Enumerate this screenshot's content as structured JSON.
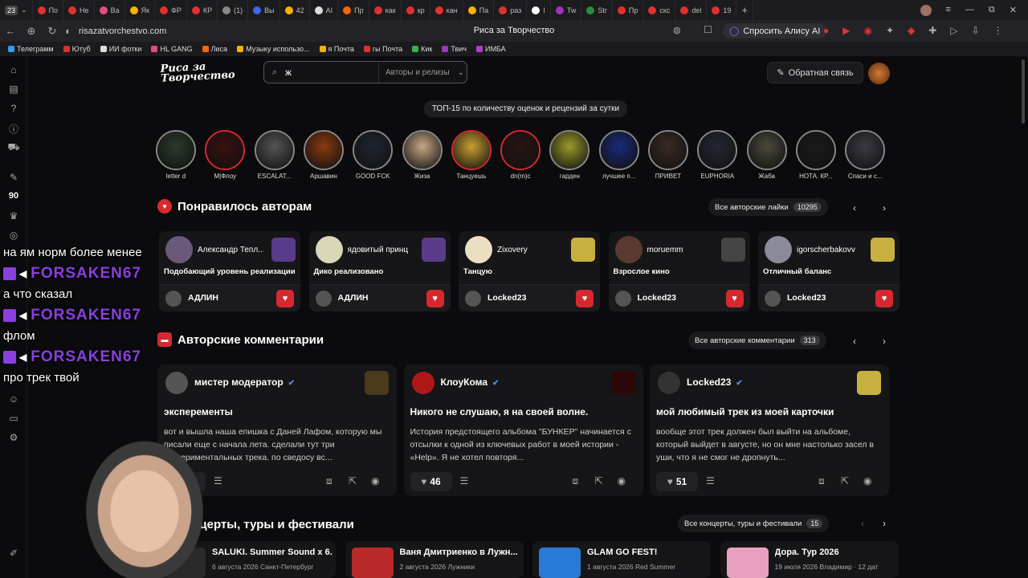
{
  "browser": {
    "tab_count": "23",
    "tabs": [
      {
        "label": "По",
        "color": "#e03131"
      },
      {
        "label": "Не",
        "color": "#e03131"
      },
      {
        "label": "Ва",
        "color": "#e64980"
      },
      {
        "label": "Як",
        "color": "#fab005"
      },
      {
        "label": "ФР",
        "color": "#e03131"
      },
      {
        "label": "КР",
        "color": "#e03131"
      },
      {
        "label": "(1)",
        "color": "#888888"
      },
      {
        "label": "Вы",
        "color": "#4263eb"
      },
      {
        "label": "42",
        "color": "#fab005"
      },
      {
        "label": "АI",
        "color": "#dddddd"
      },
      {
        "label": "Пр",
        "color": "#f76707"
      },
      {
        "label": "как",
        "color": "#e03131"
      },
      {
        "label": "кр",
        "color": "#e03131"
      },
      {
        "label": "кан",
        "color": "#e03131"
      },
      {
        "label": "Па",
        "color": "#fab005"
      },
      {
        "label": "раз",
        "color": "#e03131"
      },
      {
        "label": "I",
        "color": "#ffffff"
      },
      {
        "label": "Tw",
        "color": "#9c36b5"
      },
      {
        "label": "Str",
        "color": "#2b8a3e"
      },
      {
        "label": "Пр",
        "color": "#e03131"
      },
      {
        "label": "скс",
        "color": "#e03131"
      },
      {
        "label": "del",
        "color": "#e03131"
      },
      {
        "label": "19",
        "color": "#e03131"
      }
    ],
    "url": "risazatvorchestvo.com",
    "page_title": "Риса за Творчество",
    "alice_label": "Спросить Алису AI",
    "bookmarks": [
      {
        "label": "Телеграмм",
        "color": "#339af0"
      },
      {
        "label": "Ютуб",
        "color": "#e03131"
      },
      {
        "label": "ИИ фотки",
        "color": "#dddddd"
      },
      {
        "label": "HL GANG",
        "color": "#e64980"
      },
      {
        "label": "Лиса",
        "color": "#f76707"
      },
      {
        "label": "Музыку использо...",
        "color": "#fab005"
      },
      {
        "label": "я Почта",
        "color": "#fab005"
      },
      {
        "label": "гы Почта",
        "color": "#e03131"
      },
      {
        "label": "Кик",
        "color": "#37b24d"
      },
      {
        "label": "Твич",
        "color": "#9c36b5"
      },
      {
        "label": "ИМБА",
        "color": "#ae3ec9"
      }
    ]
  },
  "site": {
    "logo": "Риса за Творчество",
    "search_value": "ж",
    "search_scope": "Авторы и релизы",
    "feedback_label": "Обратная связь",
    "leftbar_number": "90"
  },
  "top15": {
    "badge": "ТОП-15 по количеству оценок и рецензий за сутки",
    "items": [
      {
        "label": "letter d",
        "red": false,
        "color": "#2b3a2b"
      },
      {
        "label": "M|Флоу",
        "red": true,
        "color": "#3a1010"
      },
      {
        "label": "ESCALAT...",
        "red": false,
        "color": "#555555"
      },
      {
        "label": "Аршавин",
        "red": false,
        "color": "#8a3a10"
      },
      {
        "label": "GOOD FCK",
        "red": false,
        "color": "#1f2630"
      },
      {
        "label": "Жиза",
        "red": false,
        "color": "#c9a884"
      },
      {
        "label": "Танцуешь",
        "red": true,
        "color": "#c8a030"
      },
      {
        "label": "dn(m)c",
        "red": true,
        "color": "#2a1414"
      },
      {
        "label": "гарден",
        "red": false,
        "color": "#9a9a2a"
      },
      {
        "label": "лучшее п...",
        "red": false,
        "color": "#1a2a7a"
      },
      {
        "label": "ПРИВЕТ",
        "red": false,
        "color": "#3a2a24"
      },
      {
        "label": "EUPHORIA",
        "red": false,
        "color": "#242833"
      },
      {
        "label": "Жаба",
        "red": false,
        "color": "#4a4a3a"
      },
      {
        "label": "НОТА. КР...",
        "red": false,
        "color": "#1a1a1a"
      },
      {
        "label": "Спаси и с...",
        "red": false,
        "color": "#3a3a44"
      }
    ]
  },
  "liked": {
    "title": "Понравилось авторам",
    "all_label": "Все авторские лайки",
    "all_count": "10295",
    "cards": [
      {
        "author": "Александр Тепл...",
        "evaluation": "Подобающий уровень реализации",
        "user": "АДЛИН",
        "ava": "#6a5a7a",
        "cover": "#5a3a8a"
      },
      {
        "author": "ядовитый принц",
        "evaluation": "Дико реализовано",
        "user": "АДЛИН",
        "ava": "#d8d8b8",
        "cover": "#5a3a8a"
      },
      {
        "author": "Zixovery",
        "evaluation": "Танцую",
        "user": "Locked23",
        "ava": "#e8e0c0",
        "cover": "#c8b040"
      },
      {
        "author": "moruemm",
        "evaluation": "Взрослое кино",
        "user": "Locked23",
        "ava": "#5a3a30",
        "cover": "#444444"
      },
      {
        "author": "igorscherbakovv",
        "evaluation": "Отличный баланс",
        "user": "Locked23",
        "ava": "#8a8a9a",
        "cover": "#c8b040"
      }
    ]
  },
  "comments": {
    "title": "Авторские комментарии",
    "all_label": "Все авторские комментарии",
    "all_count": "313",
    "cards": [
      {
        "author": "мистер модератор",
        "headline": "эксперементы",
        "text": "вот и вышла наша епишка с Даней Лафом, которую мы писали еще с начала лета. сделали тут три экспериментальных трека. по сведосу вс...",
        "likes": "17",
        "ava": "#555555",
        "cover": "#4a3a1a"
      },
      {
        "author": "КлоуКома",
        "headline": "Никого не слушаю, я на своей волне.",
        "text": "История предстоящего альбома \"БУНКЕР\" начинается с отсылки к одной из ключевых работ в моей истории - «Help». Я не хотел повторя...",
        "likes": "46",
        "ava": "#b01818",
        "cover": "#2a0808"
      },
      {
        "author": "Locked23",
        "headline": "мой любимый трек из моей карточки",
        "text": "вообще этот трек должен был выйти на альбоме, который выйдет в августе, но он мне настолько засел в уши, что я не смог не дропнуть...",
        "likes": "51",
        "ava": "#333333",
        "cover": "#c8b040"
      }
    ]
  },
  "events": {
    "title": "Концерты, туры и фестивали",
    "all_label": "Все концерты, туры и фестивали",
    "all_count": "15",
    "cards": [
      {
        "title": "SALUKI. Summer Sound x 6...",
        "meta": "6 августа 2026  Санкт-Петербург",
        "cover": "#2a2a2a"
      },
      {
        "title": "Ваня Дмитриенко в Лужн...",
        "meta": "2 августа 2026  Лужники",
        "cover": "#b82a2a"
      },
      {
        "title": "GLAM GO FEST!",
        "meta": "1 августа 2026  Red Summer",
        "cover": "#2a7ad8"
      },
      {
        "title": "Дора. Тур 2026",
        "meta": "19 июля 2026  Владимир · 12 дат",
        "cover": "#e8a0c0"
      }
    ]
  },
  "stream_chat": [
    {
      "text": "на ям норм более менее"
    },
    {
      "user": "FORSAKEN67"
    },
    {
      "text": "а что сказал"
    },
    {
      "user": "FORSAKEN67"
    },
    {
      "text": "флом"
    },
    {
      "user": "FORSAKEN67"
    },
    {
      "text": "про трек твой"
    }
  ]
}
